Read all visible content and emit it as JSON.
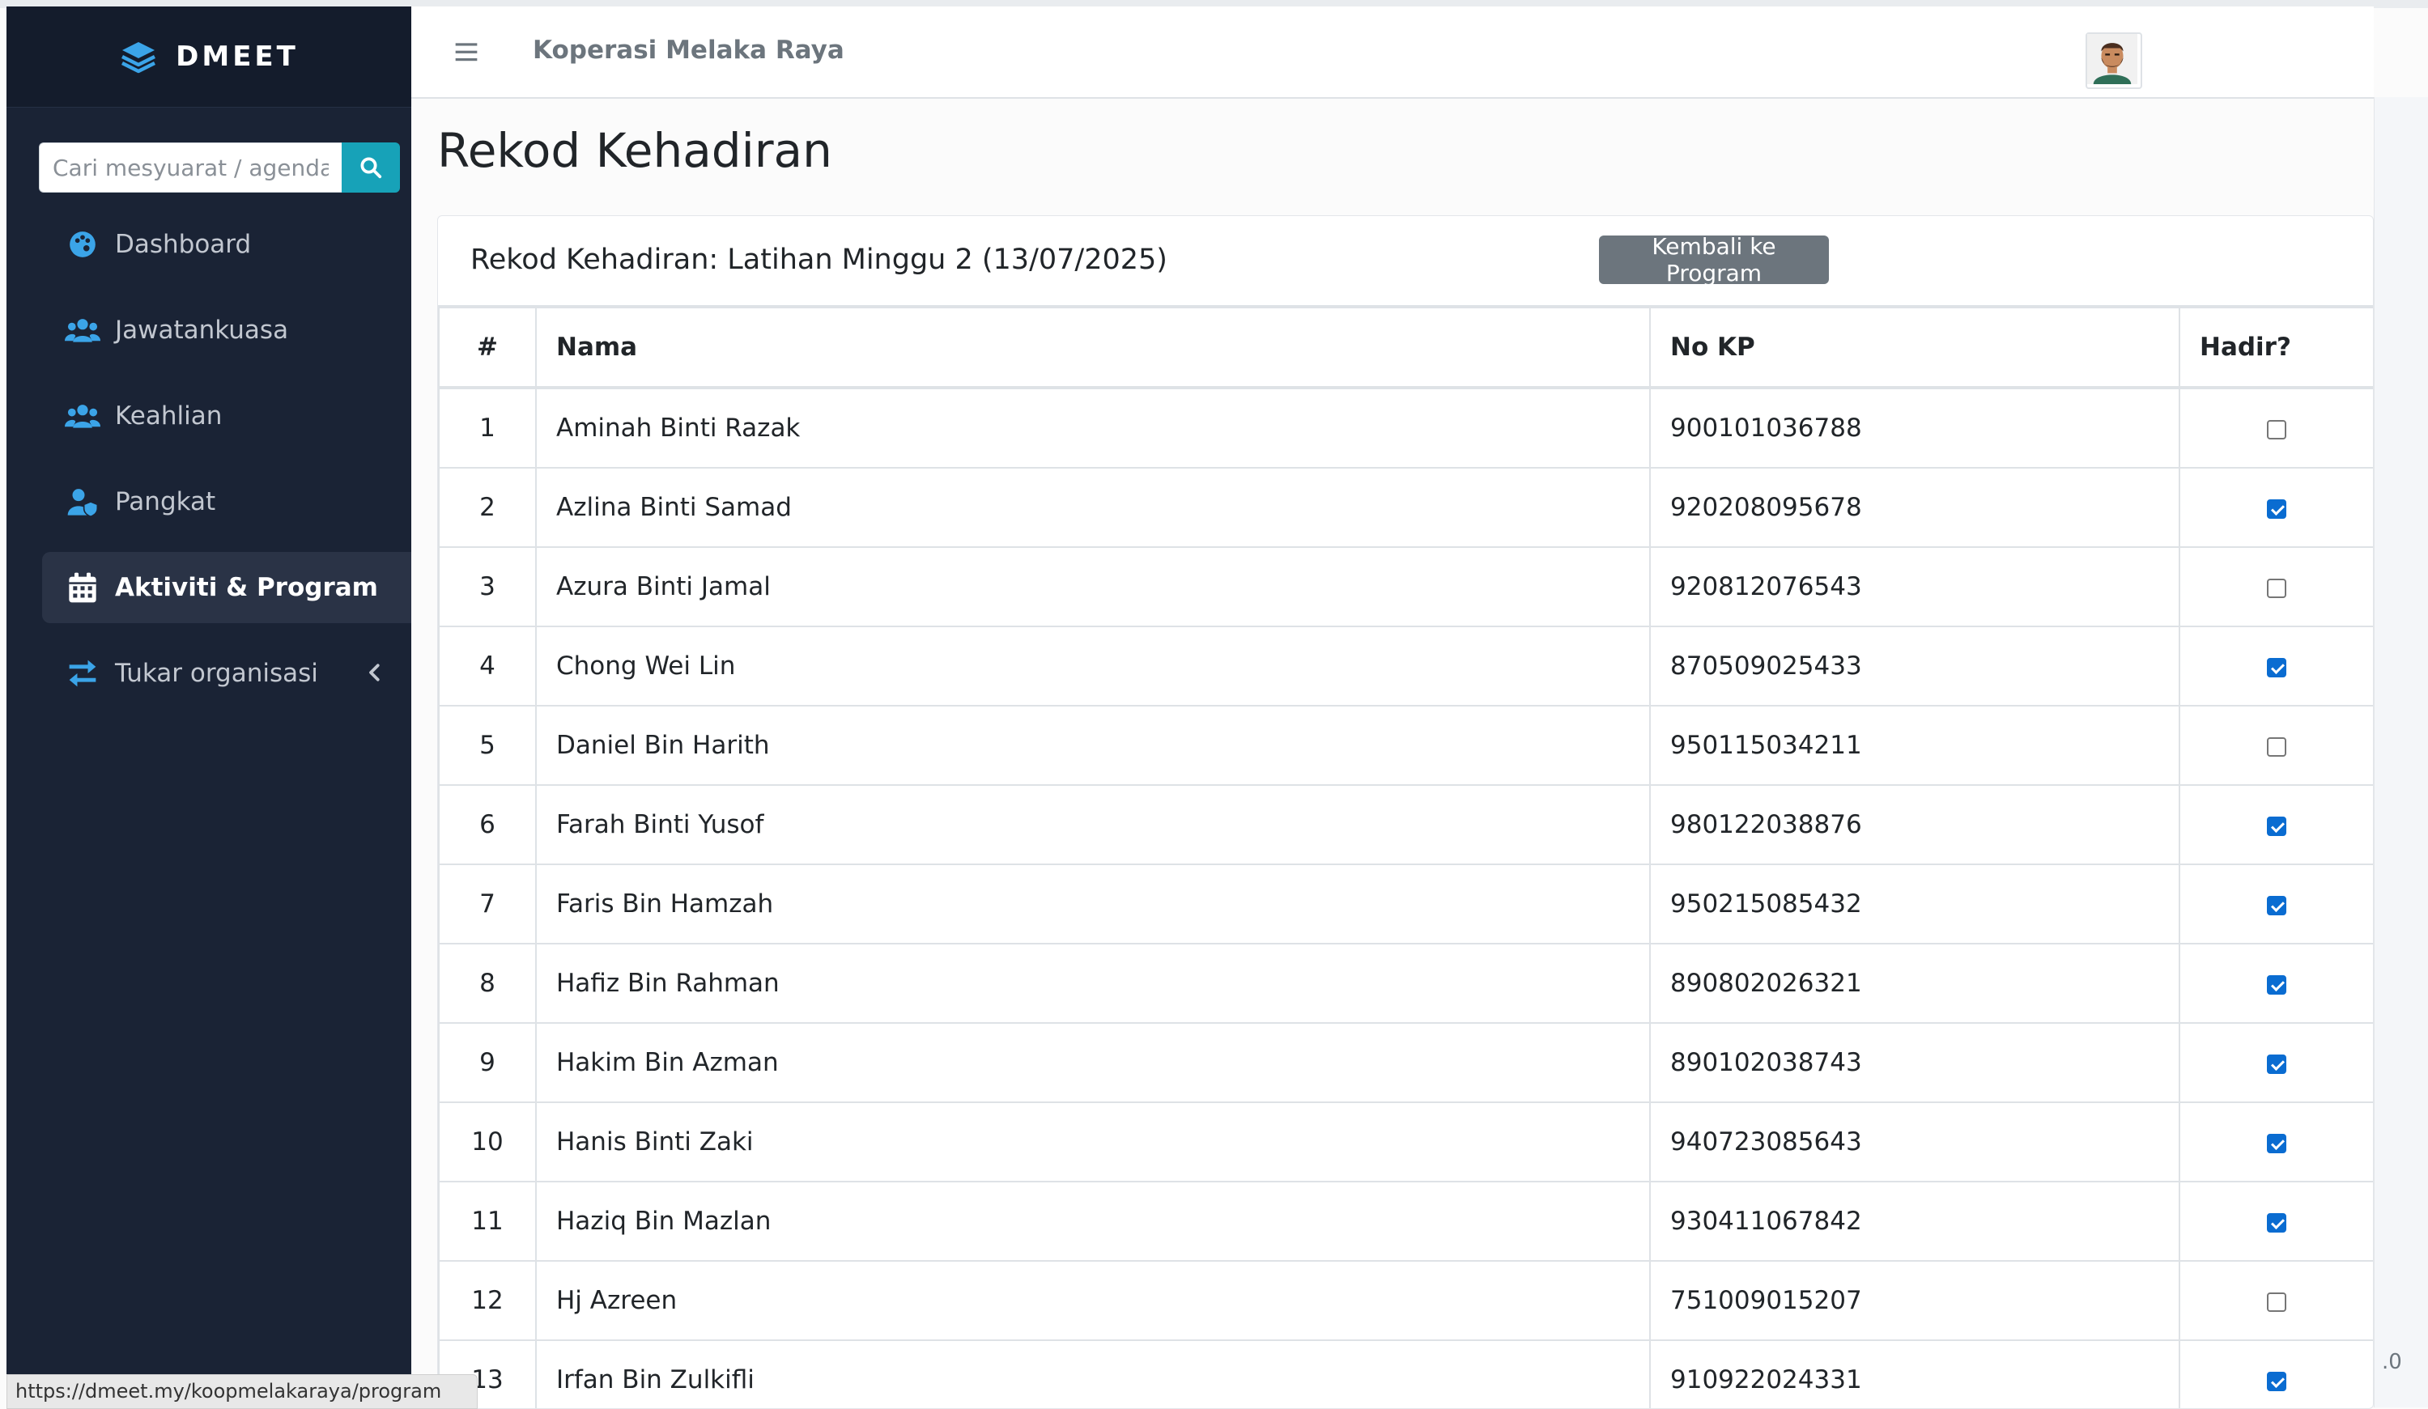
{
  "brand": {
    "name": "DMEET",
    "icon": "layers-icon"
  },
  "search": {
    "placeholder": "Cari mesyuarat / agenda.."
  },
  "sidebar": {
    "items": [
      {
        "label": "Dashboard",
        "icon": "palette-icon"
      },
      {
        "label": "Jawatankuasa",
        "icon": "users-icon"
      },
      {
        "label": "Keahlian",
        "icon": "users-icon"
      },
      {
        "label": "Pangkat",
        "icon": "user-shield-icon"
      },
      {
        "label": "Aktiviti & Program",
        "icon": "calendar-icon",
        "active": true
      },
      {
        "label": "Tukar organisasi",
        "icon": "exchange-icon"
      }
    ]
  },
  "header": {
    "org_name": "Koperasi Melaka Raya"
  },
  "page": {
    "title": "Rekod Kehadiran"
  },
  "card": {
    "title": "Rekod Kehadiran: Latihan Minggu 2 (13/07/2025)",
    "back_button": "Kembali ke Program"
  },
  "table": {
    "headers": [
      "#",
      "Nama",
      "No KP",
      "Hadir?"
    ],
    "rows": [
      {
        "no": "1",
        "name": "Aminah Binti Razak",
        "kp": "900101036788",
        "present": false
      },
      {
        "no": "2",
        "name": "Azlina Binti Samad",
        "kp": "920208095678",
        "present": true
      },
      {
        "no": "3",
        "name": "Azura Binti Jamal",
        "kp": "920812076543",
        "present": false
      },
      {
        "no": "4",
        "name": "Chong Wei Lin",
        "kp": "870509025433",
        "present": true
      },
      {
        "no": "5",
        "name": "Daniel Bin Harith",
        "kp": "950115034211",
        "present": false
      },
      {
        "no": "6",
        "name": "Farah Binti Yusof",
        "kp": "980122038876",
        "present": true
      },
      {
        "no": "7",
        "name": "Faris Bin Hamzah",
        "kp": "950215085432",
        "present": true
      },
      {
        "no": "8",
        "name": "Hafiz Bin Rahman",
        "kp": "890802026321",
        "present": true
      },
      {
        "no": "9",
        "name": "Hakim Bin Azman",
        "kp": "890102038743",
        "present": true
      },
      {
        "no": "10",
        "name": "Hanis Binti Zaki",
        "kp": "940723085643",
        "present": true
      },
      {
        "no": "11",
        "name": "Haziq Bin Mazlan",
        "kp": "930411067842",
        "present": true
      },
      {
        "no": "12",
        "name": "Hj Azreen",
        "kp": "751009015207",
        "present": false
      },
      {
        "no": "13",
        "name": "Irfan Bin Zulkifli",
        "kp": "910922024331",
        "present": true
      }
    ]
  },
  "status_bar": {
    "url": "https://dmeet.my/koopmelakaraya/program"
  },
  "footer": {
    "version": ".0"
  },
  "colors": {
    "sidebar_bg": "#1a2335",
    "accent": "#17a2b8",
    "checkbox": "#0a6cd1",
    "button_secondary": "#6c757d"
  }
}
